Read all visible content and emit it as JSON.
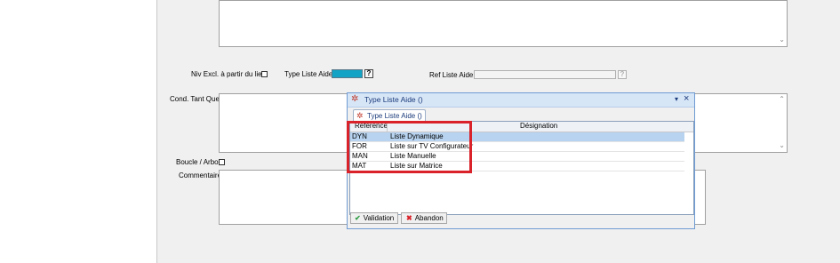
{
  "form": {
    "niv_excl_label": "Niv Excl. à partir du lien",
    "type_liste_aide_label": "Type Liste Aide",
    "type_liste_aide_help": "?",
    "ref_liste_aide_label": "Ref Liste Aide",
    "ref_liste_aide_help": "?",
    "cond_tant_que_label": "Cond. Tant Que",
    "boucle_arbo_label": "Boucle / Arbo",
    "commentaire_label": "Commentaire",
    "colors": {
      "combo_fill": "#13a3c4",
      "highlight": "#d9222a"
    }
  },
  "popup": {
    "title": "Type Liste Aide ()",
    "tab_label": "Type Liste Aide ()",
    "close_glyph": "×",
    "menu_glyph": "▾",
    "columns": {
      "reference": "Référence",
      "designation": "Désignation"
    },
    "rows": [
      {
        "reference": "DYN",
        "designation": "Liste Dynamique",
        "selected": true
      },
      {
        "reference": "FOR",
        "designation": "Liste sur TV Configurateur",
        "selected": false
      },
      {
        "reference": "MAN",
        "designation": "Liste Manuelle",
        "selected": false
      },
      {
        "reference": "MAT",
        "designation": "Liste sur Matrice",
        "selected": false
      }
    ],
    "validation_label": "Validation",
    "abandon_label": "Abandon"
  }
}
